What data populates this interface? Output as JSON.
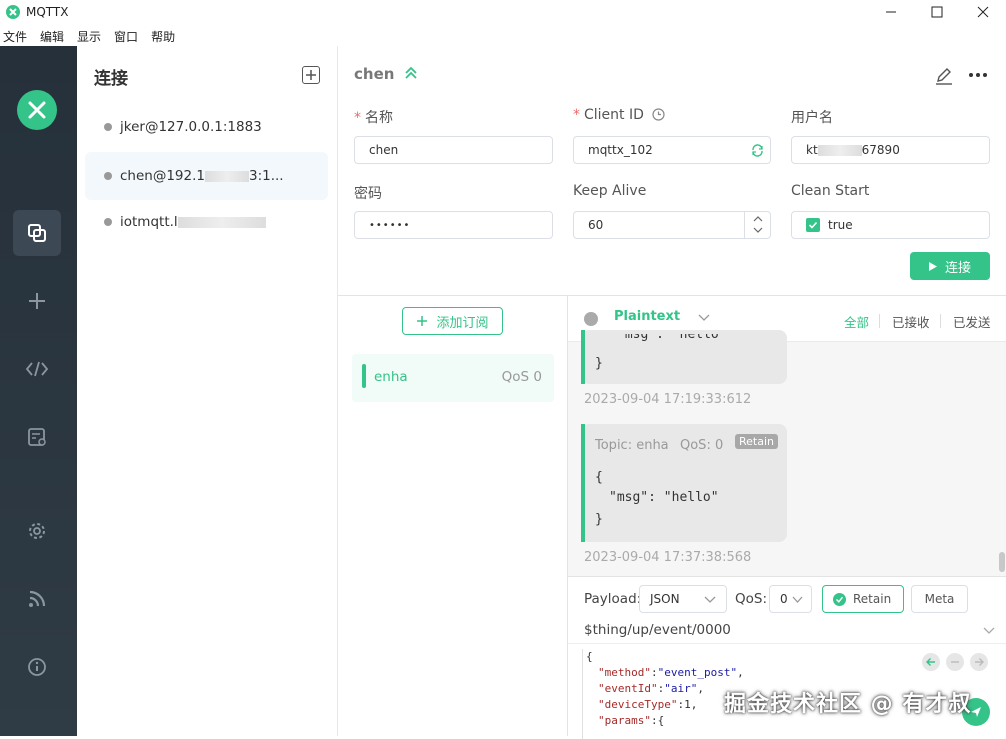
{
  "window": {
    "title": "MQTTX"
  },
  "menu": [
    "文件",
    "编辑",
    "显示",
    "窗口",
    "帮助"
  ],
  "connections_panel": {
    "title": "连接",
    "items": [
      {
        "label_prefix": "jker@127.0.0.1:1883",
        "label_suffix": "",
        "active": false
      },
      {
        "label_prefix": "chen@192.1",
        "label_suffix": "3:1...",
        "active": true
      },
      {
        "label_prefix": "iotmqtt.l",
        "label_suffix": "",
        "active": false
      }
    ]
  },
  "config": {
    "name": "chen",
    "fields": {
      "name_label": "名称",
      "name_value": "chen",
      "client_id_label": "Client ID",
      "client_id_value": "mqttx_102",
      "username_label": "用户名",
      "username_prefix": "kt",
      "username_suffix": "67890",
      "password_label": "密码",
      "password_value": "••••••",
      "keepalive_label": "Keep Alive",
      "keepalive_value": "60",
      "cleanstart_label": "Clean Start",
      "cleanstart_value": "true"
    },
    "connect_label": "连接"
  },
  "subscriptions": {
    "add_label": "添加订阅",
    "items": [
      {
        "topic": "enha",
        "qos": "QoS 0"
      }
    ]
  },
  "messages": {
    "format": "Plaintext",
    "filters": [
      "全部",
      "已接收",
      "已发送"
    ],
    "list": [
      {
        "partial_line": "\"msg\": \"hello\"",
        "close": "}",
        "time": "2023-09-04 17:19:33:612"
      },
      {
        "topic": "Topic: enha",
        "qos": "QoS: 0",
        "retain": "Retain",
        "open": "{",
        "line": "\"msg\": \"hello\"",
        "close": "}",
        "time": "2023-09-04 17:37:38:568"
      }
    ]
  },
  "publish": {
    "payload_label": "Payload:",
    "payload_format": "JSON",
    "qos_label": "QoS:",
    "qos_value": "0",
    "retain_label": "Retain",
    "meta_label": "Meta",
    "topic": "$thing/up/event/0000",
    "code": {
      "open": "{",
      "l1_key": "\"method\"",
      "l1_val": "\"event_post\"",
      "l2_key": "\"eventId\"",
      "l2_val": "\"air\"",
      "l3_key": "\"deviceType\"",
      "l3_val": "1",
      "l4_key": "\"params\"",
      "l4_val": "{"
    }
  },
  "watermark": "掘金技术社区 @ 有才叔",
  "colors": {
    "accent": "#34c388",
    "sidebar": "#25303a"
  }
}
